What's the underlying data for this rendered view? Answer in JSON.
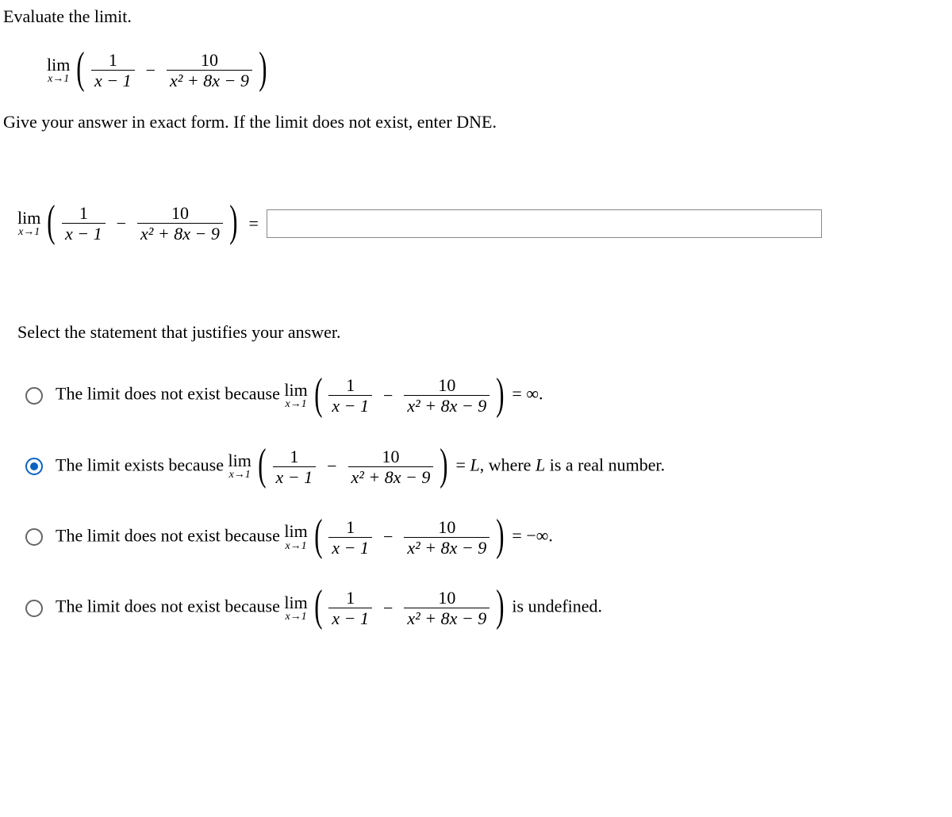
{
  "instruction": "Evaluate the limit.",
  "limitExpr": {
    "limLabel": "lim",
    "limApproach": "x→1",
    "frac1_num": "1",
    "frac1_den": "x − 1",
    "minus": "−",
    "frac2_num": "10",
    "frac2_den": "x² + 8x − 9"
  },
  "hint": "Give your answer in exact form. If the limit does not exist, enter DNE.",
  "equals": "=",
  "answerValue": "",
  "justifyHead": "Select the statement that justifies your answer.",
  "options": {
    "a": {
      "pre": "The limit does not exist because ",
      "tail": " = ∞.",
      "selected": false
    },
    "b": {
      "pre": "The limit exists because ",
      "mid": " = ",
      "L": "L",
      "tail1": ", where ",
      "tail2": " is a real number.",
      "selected": true
    },
    "c": {
      "pre": "The limit does not exist because ",
      "tail": " = −∞.",
      "selected": false
    },
    "d": {
      "pre": "The limit does not exist because ",
      "tail": " is undefined.",
      "selected": false
    }
  }
}
